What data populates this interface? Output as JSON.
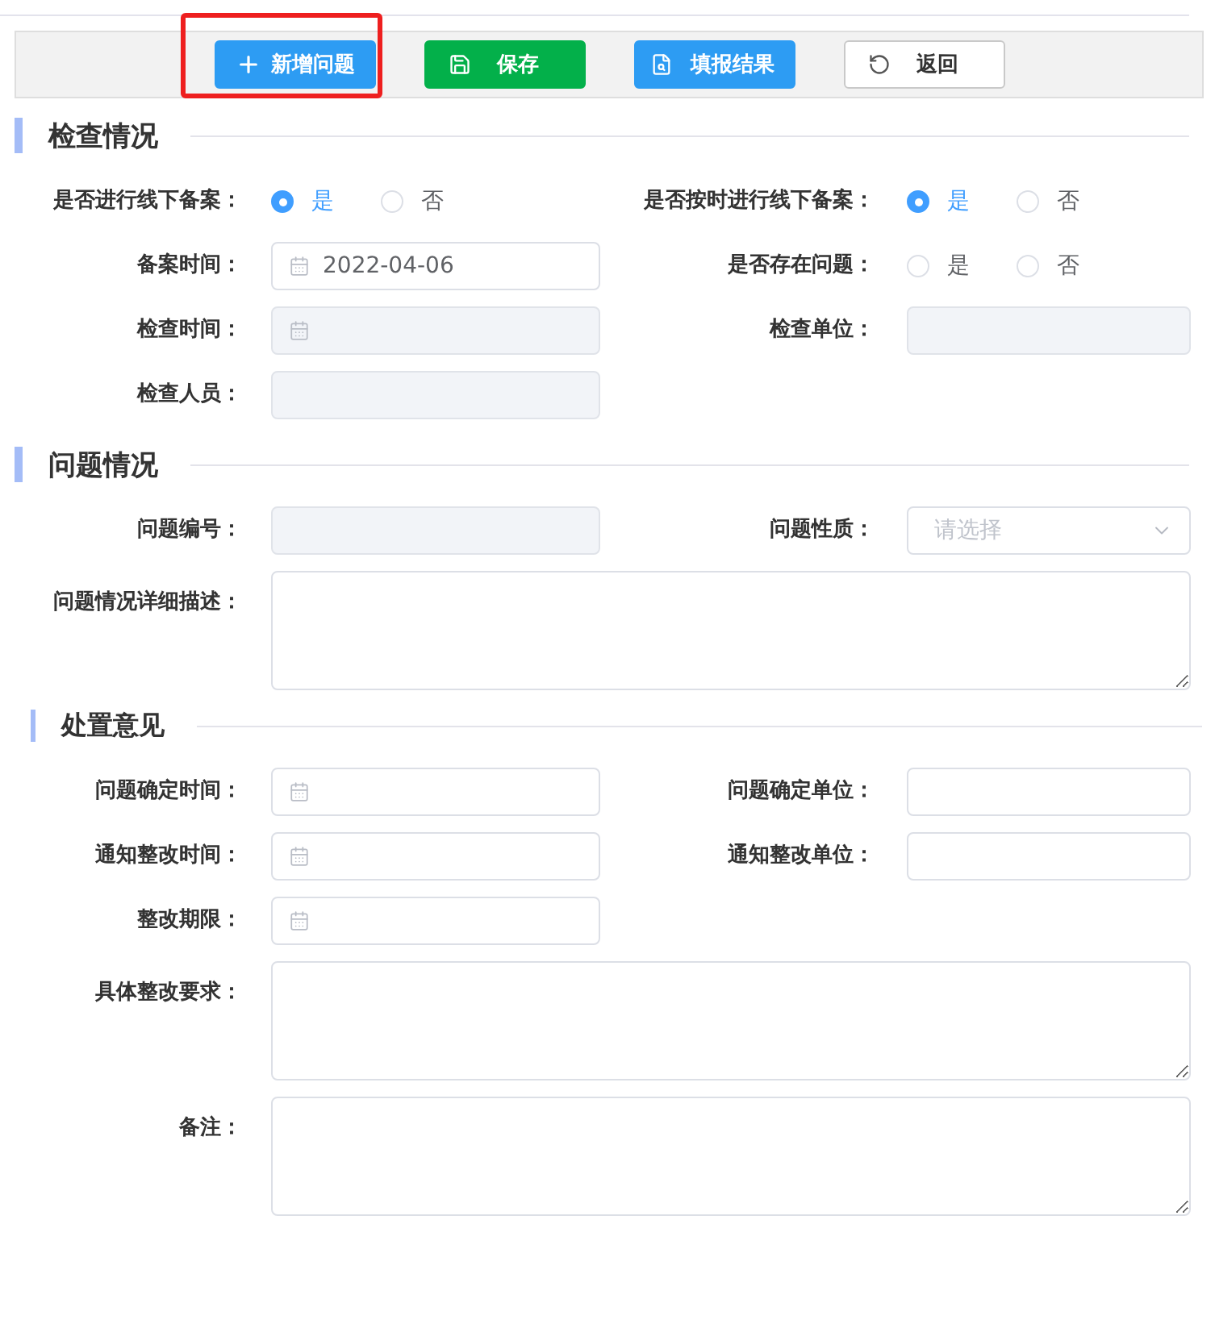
{
  "toolbar": {
    "buttons": [
      {
        "kind": "add",
        "label": "新增问题",
        "highlighted": true
      },
      {
        "kind": "save",
        "label": "保存",
        "highlighted": false
      },
      {
        "kind": "report",
        "label": "填报结果",
        "highlighted": false
      },
      {
        "kind": "back",
        "label": "返回",
        "highlighted": false
      }
    ]
  },
  "sections": [
    {
      "kind": "section",
      "title": "检查情况",
      "rows": [
        {
          "fields": [
            {
              "kind": "radio",
              "label": "是否进行线下备案：",
              "options": [
                {
                  "label": "是",
                  "selected": true
                },
                {
                  "label": "否",
                  "selected": false
                }
              ]
            },
            {
              "kind": "radio",
              "label": "是否按时进行线下备案：",
              "options": [
                {
                  "label": "是",
                  "selected": true
                },
                {
                  "label": "否",
                  "selected": false
                }
              ]
            }
          ]
        },
        {
          "fields": [
            {
              "kind": "date",
              "label": "备案时间：",
              "value": "2022-04-06",
              "disabled": false
            },
            {
              "kind": "radio",
              "label": "是否存在问题：",
              "options": [
                {
                  "label": "是",
                  "selected": false
                },
                {
                  "label": "否",
                  "selected": false
                }
              ]
            }
          ]
        },
        {
          "fields": [
            {
              "kind": "date",
              "label": "检查时间：",
              "disabled": true
            },
            {
              "kind": "text",
              "label": "检查单位：",
              "disabled": true
            }
          ]
        },
        {
          "fields": [
            {
              "kind": "text",
              "label": "检查人员：",
              "disabled": true
            }
          ]
        }
      ]
    },
    {
      "kind": "section",
      "title": "问题情况",
      "rows": [
        {
          "fields": [
            {
              "kind": "text",
              "label": "问题编号：",
              "disabled": true
            },
            {
              "kind": "select",
              "label": "问题性质：",
              "placeholder": "请选择",
              "disabled": false
            }
          ]
        },
        {
          "fields": [
            {
              "kind": "textarea",
              "label": "问题情况详细描述：",
              "disabled": false
            }
          ]
        }
      ]
    },
    {
      "kind": "subsection",
      "title": "处置意见",
      "rows": [
        {
          "fields": [
            {
              "kind": "date",
              "label": "问题确定时间：",
              "disabled": false
            },
            {
              "kind": "text",
              "label": "问题确定单位：",
              "disabled": false
            }
          ]
        },
        {
          "fields": [
            {
              "kind": "date",
              "label": "通知整改时间：",
              "disabled": false
            },
            {
              "kind": "text",
              "label": "通知整改单位：",
              "disabled": false
            }
          ]
        },
        {
          "fields": [
            {
              "kind": "date",
              "label": "整改期限：",
              "disabled": false
            }
          ]
        },
        {
          "fields": [
            {
              "kind": "textarea",
              "label": "具体整改要求：",
              "disabled": false
            }
          ]
        },
        {
          "fields": [
            {
              "kind": "textarea",
              "label": "备注：",
              "disabled": false
            }
          ]
        }
      ]
    }
  ]
}
